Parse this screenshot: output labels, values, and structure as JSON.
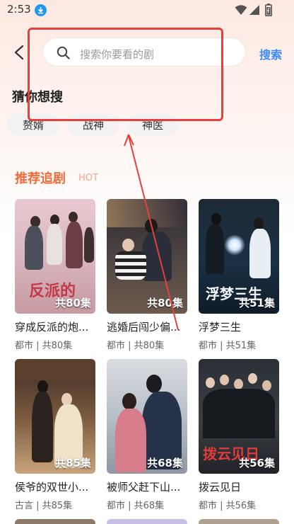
{
  "status_bar": {
    "time": "2:53"
  },
  "search": {
    "placeholder": "搜索你要看的剧",
    "button_label": "搜索"
  },
  "guess": {
    "title": "猜你想搜",
    "chips": [
      "赘婿",
      "战神",
      "神医"
    ]
  },
  "recommend": {
    "title": "推荐追剧",
    "hot_label": "HOT"
  },
  "dramas": [
    {
      "title": "穿成反派的炮...",
      "meta": "都市 | 共80集",
      "episodes": "共80集",
      "poster_text": "反派的"
    },
    {
      "title": "逃婚后闯少偏...",
      "meta": "都市 | 共80集",
      "episodes": "共80集",
      "poster_text": ""
    },
    {
      "title": "浮梦三生",
      "meta": "都市 | 共51集",
      "episodes": "共51集",
      "poster_text": "浮梦三生"
    },
    {
      "title": "侯爷的双世小...",
      "meta": "古言 | 共85集",
      "episodes": "共85集",
      "poster_text": ""
    },
    {
      "title": "被师父赶下山...",
      "meta": "都市 | 共68集",
      "episodes": "共68集",
      "poster_text": ""
    },
    {
      "title": "拨云见日",
      "meta": "都市 | 共56集",
      "episodes": "共56集",
      "poster_text": "拨云见日"
    }
  ],
  "colors": {
    "accent_orange": "#f26b3a",
    "search_blue": "#3d8cf5",
    "annotation_red": "#e54040"
  }
}
